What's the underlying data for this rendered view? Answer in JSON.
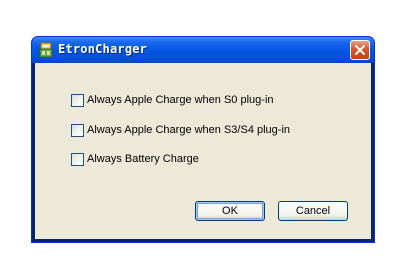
{
  "window": {
    "title": "EtronCharger",
    "icon": "app-icon",
    "close_icon": "close-icon"
  },
  "options": [
    {
      "label": "Always Apple Charge when S0 plug-in",
      "checked": false
    },
    {
      "label": "Always Apple Charge when S3/S4 plug-in",
      "checked": false
    },
    {
      "label": "Always Battery Charge",
      "checked": false
    }
  ],
  "buttons": {
    "ok_label": "OK",
    "cancel_label": "Cancel"
  },
  "colors": {
    "titlebar": "#0656e4",
    "client_bg": "#ece9d8",
    "close_button": "#d9552b",
    "checkbox_border": "#1c5180"
  }
}
